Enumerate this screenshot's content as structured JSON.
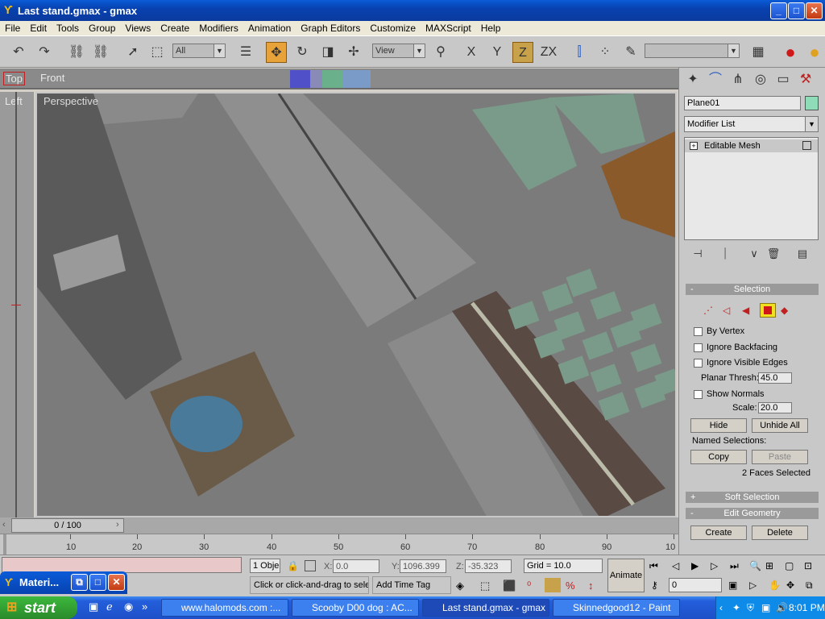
{
  "window": {
    "title": "Last stand.gmax - gmax",
    "min": "_",
    "max": "□",
    "close": "✕"
  },
  "menu": [
    "File",
    "Edit",
    "Tools",
    "Group",
    "Views",
    "Create",
    "Modifiers",
    "Animation",
    "Graph Editors",
    "Customize",
    "MAXScript",
    "Help"
  ],
  "toolbar": {
    "filter_select": "All",
    "coord_select": "View",
    "axis_x": "X",
    "axis_y": "Y",
    "axis_z": "Z",
    "axis_zx": "ZX"
  },
  "viewports": {
    "top": "Top",
    "front": "Front",
    "left": "Left",
    "perspective": "Perspective"
  },
  "command_panel": {
    "object_name": "Plane01",
    "object_color": "#8fdcb8",
    "modifier_list": "Modifier List",
    "stack_item": "Editable Mesh",
    "selection": {
      "header": "Selection",
      "by_vertex": "By Vertex",
      "ignore_backfacing": "Ignore Backfacing",
      "ignore_visible_edges": "Ignore Visible Edges",
      "planar_thresh_label": "Planar Thresh:",
      "planar_thresh": "45.0",
      "show_normals": "Show Normals",
      "scale_label": "Scale:",
      "scale": "20.0",
      "hide": "Hide",
      "unhide_all": "Unhide All",
      "named_selections": "Named Selections:",
      "copy": "Copy",
      "paste": "Paste",
      "status": "2 Faces Selected"
    },
    "soft_selection": "Soft Selection",
    "edit_geometry": "Edit Geometry",
    "create": "Create",
    "delete": "Delete"
  },
  "timeline": {
    "position": "0 / 100",
    "ticks": [
      "10",
      "20",
      "30",
      "40",
      "50",
      "60",
      "70",
      "80",
      "90",
      "10"
    ]
  },
  "status": {
    "objects": "1 Obje",
    "x_label": "X:",
    "x": "0.0",
    "y_label": "Y:",
    "y": "1096.399",
    "z_label": "Z:",
    "z": "-35.323",
    "grid": "Grid = 10.0",
    "prompt": "Click or click-and-drag to selec",
    "add_time_tag": "Add Time Tag",
    "animate": "Animate",
    "frame": "0"
  },
  "material_window": {
    "title": "Materi..."
  },
  "taskbar": {
    "start": "start",
    "tasks": [
      "www.halomods.com :...",
      "Scooby D00 dog : AC...",
      "Last stand.gmax - gmax",
      "Skinnedgood12 - Paint"
    ],
    "clock": "8:01 PM"
  }
}
